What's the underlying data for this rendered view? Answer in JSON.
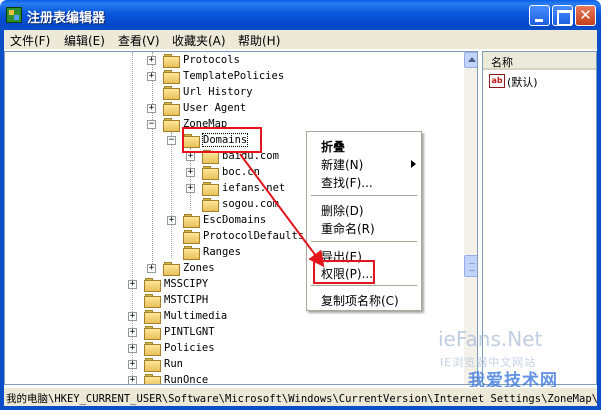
{
  "window": {
    "title": "注册表编辑器",
    "controls": [
      "minimize",
      "maximize",
      "close"
    ]
  },
  "menubar": [
    {
      "label": "文件(F)"
    },
    {
      "label": "编辑(E)"
    },
    {
      "label": "查看(V)"
    },
    {
      "label": "收藏夹(A)"
    },
    {
      "label": "帮助(H)"
    }
  ],
  "tree": {
    "nodes": [
      {
        "label": "Protocols",
        "expander": "+"
      },
      {
        "label": "TemplatePolicies",
        "expander": "+"
      },
      {
        "label": "Url History",
        "expander": ""
      },
      {
        "label": "User Agent",
        "expander": "+"
      },
      {
        "label": "ZoneMap",
        "expander": "−"
      },
      {
        "label": "Domains",
        "expander": "−",
        "selected": true
      },
      {
        "label": "baidu.com",
        "expander": "+"
      },
      {
        "label": "boc.cn",
        "expander": "+"
      },
      {
        "label": "iefans.net",
        "expander": "+"
      },
      {
        "label": "sogou.com",
        "expander": ""
      },
      {
        "label": "EscDomains",
        "expander": "+"
      },
      {
        "label": "ProtocolDefaults",
        "expander": ""
      },
      {
        "label": "Ranges",
        "expander": ""
      },
      {
        "label": "Zones",
        "expander": "+"
      },
      {
        "label": "MSSCIPY",
        "expander": "+"
      },
      {
        "label": "MSTCIPH",
        "expander": ""
      },
      {
        "label": "Multimedia",
        "expander": "+"
      },
      {
        "label": "PINTLGNT",
        "expander": "+"
      },
      {
        "label": "Policies",
        "expander": "+"
      },
      {
        "label": "Run",
        "expander": "+"
      },
      {
        "label": "RunOnce",
        "expander": "+"
      }
    ]
  },
  "values_pane": {
    "header": "名称",
    "rows": [
      {
        "icon": "string-value-icon",
        "icon_text": "ab",
        "name": "(默认)"
      }
    ]
  },
  "context_menu": {
    "items": [
      {
        "label": "折叠",
        "bold": true
      },
      {
        "label": "新建(N)",
        "submenu": true
      },
      {
        "label": "查找(F)..."
      },
      {
        "label": "删除(D)"
      },
      {
        "label": "重命名(R)"
      },
      {
        "label": "导出(E)"
      },
      {
        "label": "权限(P)...",
        "highlighted": true
      },
      {
        "label": "复制项名称(C)"
      }
    ]
  },
  "statusbar": {
    "path": "我的电脑\\HKEY_CURRENT_USER\\Software\\Microsoft\\Windows\\CurrentVersion\\Internet Settings\\ZoneMap\\Domains"
  },
  "watermark": {
    "site": "ieFans.Net",
    "subtitle": "IE浏览器中文网站",
    "slogan": "我爱技术网"
  },
  "colors": {
    "titlebar": "#0a4fc8",
    "annotation_red": "#e3141c",
    "menubar_bg": "#ece9d8"
  }
}
